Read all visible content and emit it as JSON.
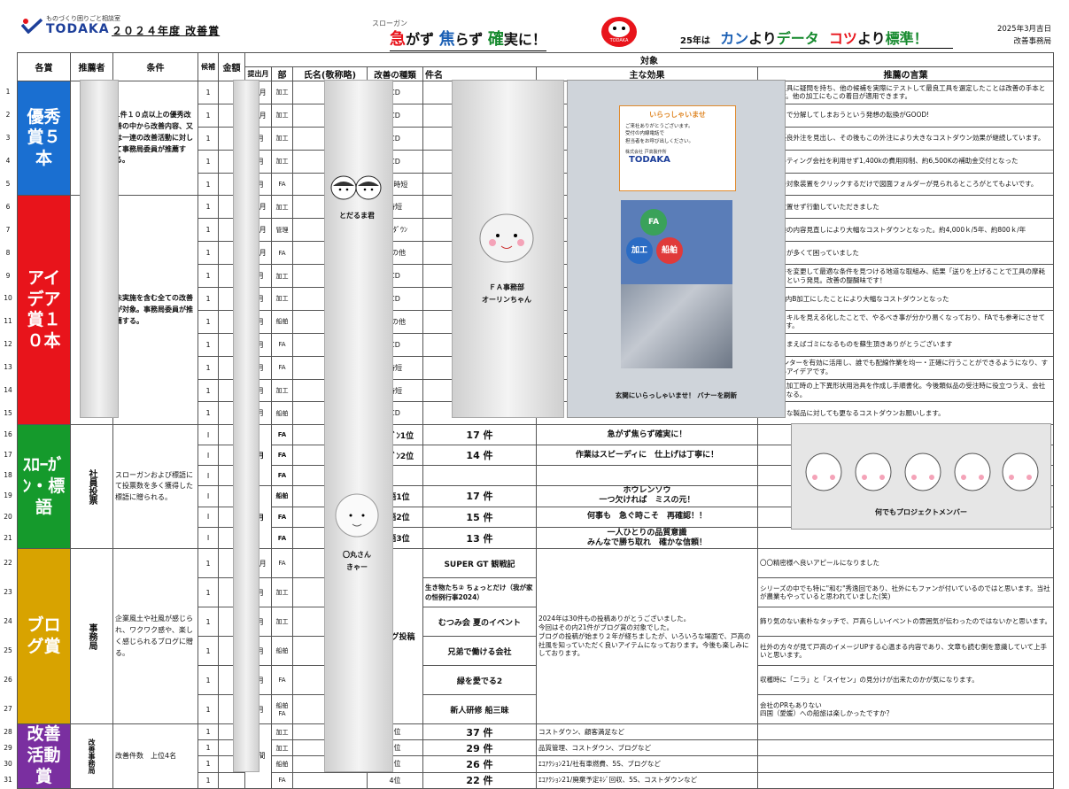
{
  "header": {
    "logo_small": "ものづくり困りごと相談室",
    "logo_name": "TODAKA",
    "title": "２０２４年度  改善賞",
    "slogan_ruby": "スローガン",
    "slogan_parts": [
      "急",
      "がず ",
      "焦",
      "らず ",
      "確",
      "実に！"
    ],
    "daruma_text": "TODAKA",
    "motto_small": "25年は",
    "motto_parts": [
      "カン",
      "より",
      "データ",
      "コツ",
      "より",
      "標準！"
    ],
    "date": "2025年3月吉日",
    "dept": "改善事務局",
    "colors": {
      "red": "#e8141b",
      "blue": "#1a5fb4",
      "green": "#168a2e"
    }
  },
  "table": {
    "headers": {
      "award": "各賞",
      "nominator": "推薦者",
      "condition": "条件",
      "candidate": "候補",
      "amount": "金額",
      "month": "提出月",
      "division": "部",
      "name": "氏名(敬称略)",
      "kind": "改善の種類",
      "target": "対象",
      "item": "件名",
      "effect": "主な効果",
      "words": "推薦の言葉"
    },
    "awards": {
      "yushu": {
        "label": "優秀賞５本",
        "color": "#1a6fd1"
      },
      "idea": {
        "label": "アイデア賞１０本",
        "color": "#e8141b"
      },
      "slogan": {
        "label": "ｽﾛｰｶﾞﾝ・標語",
        "color": "#159a2c"
      },
      "blog": {
        "label": "ブログ賞",
        "color": "#d8a300"
      },
      "katsudo": {
        "label": "改善活動賞",
        "color": "#7a2fa0"
      }
    },
    "conditions": {
      "yushu": "1件１０点以上の優秀改善の中から改善内容、又は一連の改善活動に対して事務局委員が推薦する。",
      "idea": "未実施を含む全ての改善が対象。事務局委員が推薦する。",
      "slogan": "スローガンおよび標語にて投票数を多く獲得した標語に贈られる。",
      "blog": "企業風土や社風が感じられ、ワクワク感や、楽しく感じられるブログに贈る。",
      "katsudo": "改善件数　上位4名"
    },
    "nominators": {
      "slogan": "社員投票",
      "blog": "事務局",
      "katsudo": "改善事務局"
    },
    "rows": [
      {
        "n": "1",
        "cand": "1",
        "month": "12月",
        "div": "加工",
        "kind": "CD",
        "words": "従来の工具に疑問を持ち、他の候補を実際にテストして最良工具を選定したことは改善の手本と思います。他の加工にもこの着目が適用できます。"
      },
      {
        "n": "2",
        "cand": "1",
        "month": "11月",
        "div": "加工",
        "kind": "CD",
        "words": "自分たちで分解してしまおうという発想の転換がGOOD!"
      },
      {
        "n": "3",
        "cand": "1",
        "month": "6月",
        "div": "加工",
        "kind": "CD",
        "words": "新たな優良外注を見出し、その後もこの外注により大きなコストダウン効果が継続しています。"
      },
      {
        "n": "4",
        "cand": "1",
        "month": "9月",
        "div": "加工",
        "kind": "CD",
        "words": "コンサルティング会社を利用せず1,400kの費用抑制、約6,500Kの補助金交付となった"
      },
      {
        "n": "5",
        "cand": "1",
        "month": "9月",
        "div": "FA",
        "kind": "5S  時短",
        "words": "工程表の対象装置をクリックするだけで図面フォルダーが見られるところがとてもよいです。"
      },
      {
        "n": "6",
        "cand": "1",
        "month": "11月",
        "div": "加工",
        "kind": "時短",
        "words": "問題を放置せず行動していただきました"
      },
      {
        "n": "7",
        "cand": "1",
        "month": "10月",
        "div": "管理",
        "kind": "ｺｽﾄﾀﾞｳﾝ",
        "words": "火災保険の内容見直しにより大幅なコストダウンとなった。約4,000ｋ/5年、約800ｋ/年"
      },
      {
        "n": "8",
        "cand": "1",
        "month": "12月",
        "div": "FA",
        "kind": "その他",
        "words": "計算ミスが多くて困っていました"
      },
      {
        "n": "9",
        "cand": "1",
        "month": "6月",
        "div": "加工",
        "kind": "CD",
        "words": "加工条件を変更して最適な条件を見つける地道な取組み、結果「送りを上げることで工具の摩耗も改善」という発見。改善の醍醐味です！"
      },
      {
        "n": "10",
        "cand": "1",
        "month": "9月",
        "div": "加工",
        "kind": "CD",
        "words": "材料→社内B加工にしたことにより大幅なコストダウンとなった"
      },
      {
        "n": "11",
        "cand": "1",
        "month": "4月",
        "div": "船舶",
        "kind": "その他",
        "words": "各自のスキルを見える化したことで、やるべき事が分かり易くなっており、FAでも参考にさせて頂いてます。"
      },
      {
        "n": "12",
        "cand": "1",
        "month": "6月",
        "div": "FA",
        "kind": "CD",
        "words": "捨ててしまえばゴミになるものを蘇生頂きありがとうございます"
      },
      {
        "n": "13",
        "cand": "1",
        "month": "4月",
        "div": "FA",
        "kind": "時短",
        "words": "3Dプリンターを有効に活用し、誰でも配線作業を均一・正確に行うことができるようになり、すばらしいアイデアです。"
      },
      {
        "n": "14",
        "cand": "1",
        "month": "5月",
        "div": "加工",
        "kind": "時短",
        "words": "ワイヤー加工時の上下異形状用治具を作成し手順書化。今後類似品の受注時に役立つうえ、会社の財産となる。"
      },
      {
        "n": "15",
        "cand": "1",
        "month": "4月",
        "div": "船舶",
        "kind": "CD",
        "words": "いろいろな製品に対しても更なるコストダウンお願いします。"
      }
    ],
    "slogan_rows": [
      {
        "n": "16",
        "cand": "Ⅰ",
        "div": "FA",
        "rank": "ｽﾛｰｶﾞﾝ1位",
        "count": "17  件",
        "text": "急がず焦らず確実に！"
      },
      {
        "n": "17",
        "cand": "Ⅰ",
        "div": "FA",
        "rank": "ｽﾛｰｶﾞﾝ2位",
        "count": "14  件",
        "text": "作業はスピーディに　仕上げは丁寧に！"
      },
      {
        "n": "18",
        "cand": "Ⅰ",
        "div": "FA",
        "rank": "",
        "count": "",
        "text": ""
      },
      {
        "n": "19",
        "cand": "Ⅰ",
        "div": "船舶",
        "rank": "標語1位",
        "count": "17  件",
        "text": "ホウレンソウ\n一つ欠ければ　ミスの元！"
      },
      {
        "n": "20",
        "cand": "Ⅰ",
        "div": "FA",
        "rank": "標語2位",
        "count": "15  件",
        "text": "何事も　急ぐ時こそ　再確認！！"
      },
      {
        "n": "21",
        "cand": "Ⅰ",
        "div": "FA",
        "rank": "標語3位",
        "count": "13  件",
        "text": "一人ひとりの品質意識\nみんなで勝ち取れ　確かな信頼！"
      }
    ],
    "slogan_month_a": "1月",
    "slogan_month_b": "5月",
    "blog_rows": [
      {
        "n": "22",
        "cand": "1",
        "month": "10月",
        "div": "FA",
        "title": "SUPER GT  観戦記",
        "words": "〇〇精密様へ良いアピールになりました"
      },
      {
        "n": "23",
        "cand": "1",
        "month": "8月",
        "div": "加工",
        "title": "生き物たち②  ちょっとだけ（我が家の恒例行事2024）",
        "words": "シリーズの中でも特に\"和む\"秀逸回であり、社外にもファンが付いているのではと思います。当社が農業もやっていると思われていました(笑)"
      },
      {
        "n": "24",
        "cand": "1",
        "month": "8月",
        "div": "加工",
        "title": "むつみ会  夏のイベント",
        "words": "飾り気のない素朴なタッチで、戸高らしいイベントの雰囲気が伝わったのではないかと思います。"
      },
      {
        "n": "25",
        "cand": "1",
        "month": "6月",
        "div": "船舶",
        "title": "兄弟で働ける会社",
        "words": "社外の方々が見て戸高のイメージUPする心温まる内容であり、文章も読む側を意識していて上手いと思います。"
      },
      {
        "n": "26",
        "cand": "1",
        "month": "6月",
        "div": "FA",
        "title": "緑を愛でる2",
        "words": "収穫時に「ニラ」と「スイセン」の見分けが出来たのかが気になります。"
      },
      {
        "n": "27",
        "cand": "1",
        "month": "5月",
        "div": "船舶\nFA",
        "title": "新人研修  船三昧",
        "words": "会社のPRもありない\n四国（愛媛）への船旅は楽しかったですか？"
      }
    ],
    "blog_kind": "ブログ投稿",
    "blog_effect": "2024年は30件もの投稿ありがとうございました。\n今回はその内21件がブログ賞の対象でした。\nブログの投稿が始まり２年が経ちましたが、いろいろな場面で、戸高の社風を知っていただく良いアイテムになっております。今後も楽しみにしております。",
    "katsudo_rows": [
      {
        "n": "28",
        "cand": "1",
        "div": "加工",
        "rank": "1位",
        "count": "37  件",
        "effect": "コストダウン、顧客満足など"
      },
      {
        "n": "29",
        "cand": "1",
        "div": "加工",
        "rank": "2位",
        "count": "29  件",
        "effect": "品質管理、コストダウン、ブログなど"
      },
      {
        "n": "30",
        "cand": "1",
        "div": "船舶",
        "rank": "3位",
        "count": "26  件",
        "effect": "ｴｺｱｸｼｮﾝ21/社有車燃費、5S、ブログなど"
      },
      {
        "n": "31",
        "cand": "1",
        "div": "FA",
        "rank": "4位",
        "count": "22  件",
        "effect": "ｴｺｱｸｼｮﾝ21/廃棄予定ﾈｼﾞ回収、5S、コストダウンなど"
      }
    ],
    "katsudo_month": "年間"
  },
  "overlays": {
    "todaruma": "とだるま君",
    "orin": "ＦＡ事務部\nオーリンちゃん",
    "maru": "〇丸さん\nきゃー",
    "poster_title": "いらっしゃいませ",
    "poster_text": "ご来社ありがとうございます。\n受付の内線電話で\n担当者をお呼び出しください。",
    "poster_company": "株式会社 戸高製作所",
    "poster_logo": "TODAKA",
    "poster_circles": [
      "FA",
      "加工",
      "船舶"
    ],
    "poster_caption": "玄関にいらっしゃいませ！ バナーを刷新",
    "project": "何でもプロジェクトメンバー"
  }
}
